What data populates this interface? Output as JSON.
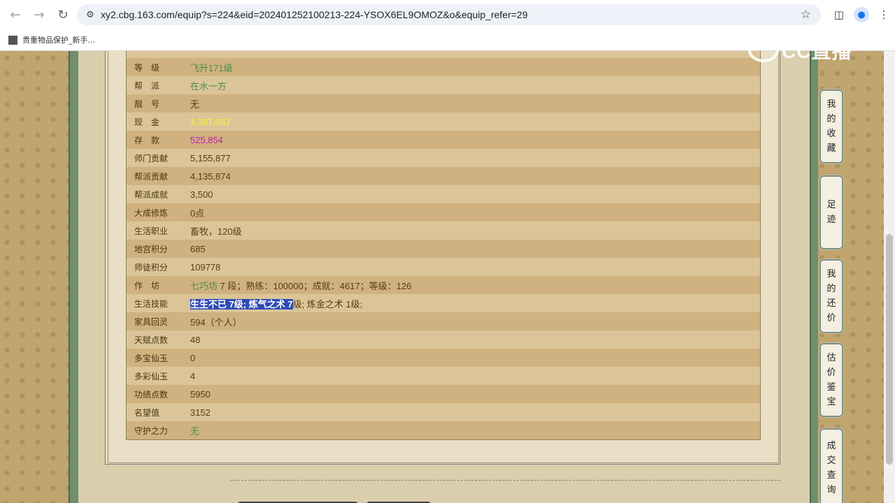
{
  "browser": {
    "url": "xy2.cbg.163.com/equip?s=224&eid=202401252100213-224-YSOX6EL9OMOZ&o&equip_refer=29",
    "bookmark_label": "贵重物品保护_新手..."
  },
  "logo": {
    "text": "CC直播"
  },
  "attributes": [
    {
      "label": "等　级",
      "value": "飞升171级",
      "color": "green"
    },
    {
      "label": "帮　派",
      "value": "在水一方",
      "color": "green"
    },
    {
      "label": "靓　号",
      "value": "无",
      "color": "default"
    },
    {
      "label": "现　金",
      "value": "3,387,057",
      "color": "yellow"
    },
    {
      "label": "存　款",
      "value": "525,854",
      "color": "magenta"
    },
    {
      "label": "师门贡献",
      "value": "5,155,877",
      "color": "default"
    },
    {
      "label": "帮派贡献",
      "value": "4,135,874",
      "color": "default"
    },
    {
      "label": "帮派成就",
      "value": "3,500",
      "color": "default"
    },
    {
      "label": "大成修炼",
      "value": "0点",
      "color": "default"
    },
    {
      "label": "生活职业",
      "value": "畜牧，120级",
      "color": "default"
    },
    {
      "label": "地宫积分",
      "value": "685",
      "color": "default"
    },
    {
      "label": "师徒积分",
      "value": "109778",
      "color": "default"
    },
    {
      "label": "作　坊",
      "value_prefix": "七巧坊",
      "value_rest": " 7 段；熟练：100000；成就：4617；等级：126",
      "color": "green"
    },
    {
      "label": "生活技能",
      "value_selected": "生生不已 7级; 炼气之术 7",
      "value_rest": "级; 炼金之术 1级;",
      "color": "default"
    },
    {
      "label": "家具回灵",
      "value": "594（个人）",
      "color": "default"
    },
    {
      "label": "天赋点数",
      "value": "48",
      "color": "default"
    },
    {
      "label": "多宝仙玉",
      "value": "0",
      "color": "default"
    },
    {
      "label": "多彩仙玉",
      "value": "4",
      "color": "default"
    },
    {
      "label": "功绩点数",
      "value": "5950",
      "color": "default"
    },
    {
      "label": "名望值",
      "value": "3152",
      "color": "default"
    },
    {
      "label": "守护之力",
      "value": "无",
      "color": "green"
    }
  ],
  "side_buttons": [
    {
      "chars": [
        "我",
        "的",
        "收",
        "藏"
      ]
    },
    {
      "chars": [
        "足",
        "迹"
      ]
    },
    {
      "chars": [
        "我",
        "的",
        "还",
        "价"
      ]
    },
    {
      "chars": [
        "估",
        "价",
        "鉴",
        "宝"
      ]
    },
    {
      "chars": [
        "成",
        "交",
        "查",
        "询"
      ]
    }
  ]
}
